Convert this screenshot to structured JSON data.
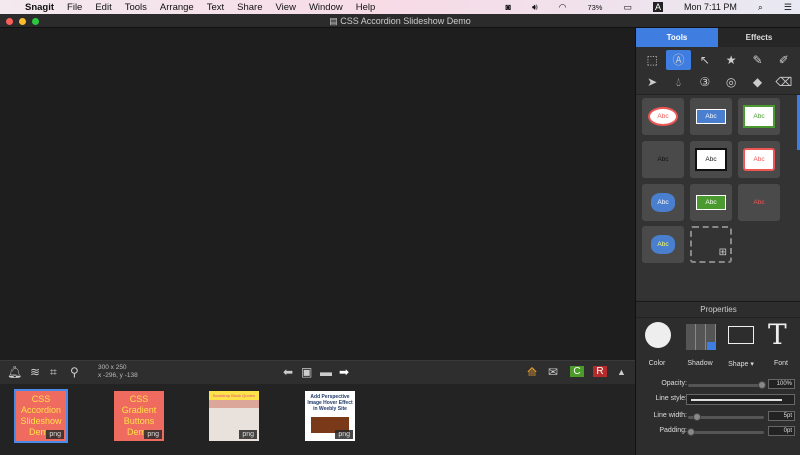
{
  "menubar": {
    "app": "Snagit",
    "items": [
      "File",
      "Edit",
      "Tools",
      "Arrange",
      "Text",
      "Share",
      "View",
      "Window",
      "Help"
    ],
    "battery": "73%",
    "input_source": "A",
    "clock": "Mon 7:11 PM"
  },
  "window": {
    "title": "CSS Accordion Slideshow Demo"
  },
  "toolbar": {
    "size": "300 x 250",
    "coords": "x -296, y -138"
  },
  "thumbnails": [
    {
      "title": "CSS Accordion Slideshow Demo",
      "type": "png",
      "selected": true
    },
    {
      "title": "CSS Gradient Buttons Demo",
      "type": "png"
    },
    {
      "title": "Bootstrap Block Quotes",
      "type": "png"
    },
    {
      "title": "Add Perspective Image Hover Effect in Weebly Site",
      "type": "png"
    }
  ],
  "panel": {
    "tabs": [
      "Tools",
      "Effects"
    ],
    "active_tab": "Tools",
    "accent": "#3f7ee0",
    "tools": [
      "selection",
      "callout",
      "arrow",
      "stamp",
      "pen",
      "highlighter",
      "move",
      "fill",
      "step",
      "magnify",
      "fill-bucket",
      "eraser"
    ],
    "style_label": "Abc",
    "properties": {
      "title": "Properties",
      "color": "Color",
      "shadow": "Shadow",
      "shape": "Shape",
      "font": "Font",
      "opacity_label": "Opacity:",
      "opacity": "100%",
      "line_style_label": "Line style:",
      "line_width_label": "Line width:",
      "line_width": "5pt",
      "padding_label": "Padding:",
      "padding": "0pt"
    }
  }
}
